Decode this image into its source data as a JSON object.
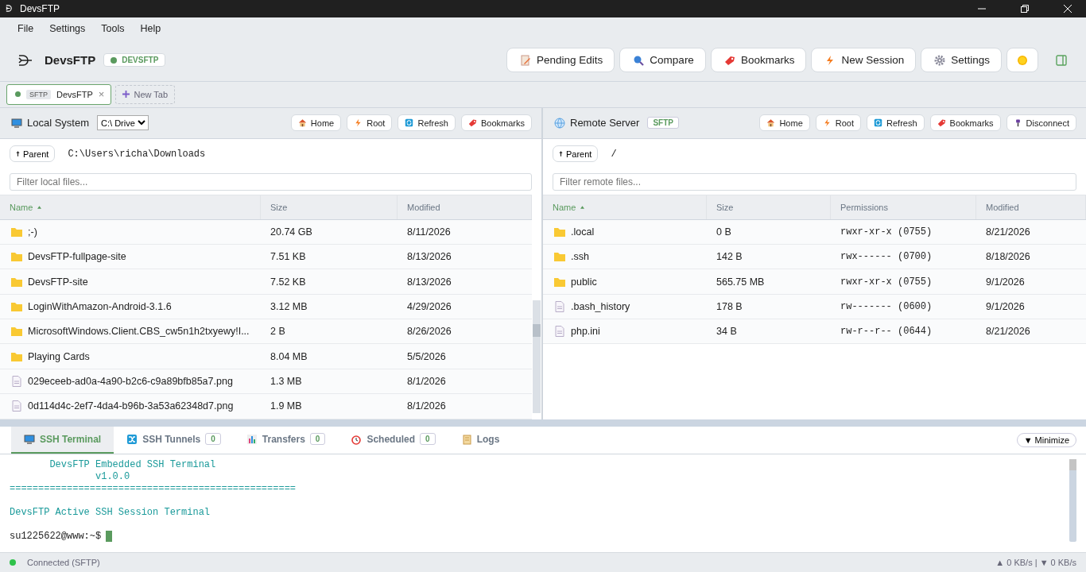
{
  "window": {
    "title": "DevsFTP"
  },
  "menu": [
    "File",
    "Settings",
    "Tools",
    "Help"
  ],
  "header": {
    "app_name": "DevsFTP",
    "badge": "DEVSFTP",
    "buttons": [
      {
        "label": "Pending Edits",
        "kind": "edit"
      },
      {
        "label": "Compare",
        "kind": "search"
      },
      {
        "label": "Bookmarks",
        "kind": "bookmark"
      },
      {
        "label": "New Session",
        "kind": "bolt"
      },
      {
        "label": "Settings",
        "kind": "gear"
      }
    ]
  },
  "session_tabs": [
    {
      "protocol": "SFTP",
      "label": "DevsFTP",
      "close": "×",
      "selected": true
    }
  ],
  "new_tab": "New Tab",
  "local": {
    "title": "Local System",
    "drive": "C:\\ Drive",
    "buttons": [
      {
        "label": "Home",
        "kind": "home"
      },
      {
        "label": "Root",
        "kind": "bolt"
      },
      {
        "label": "Refresh",
        "kind": "refresh"
      },
      {
        "label": "Bookmarks",
        "kind": "bookmark"
      }
    ],
    "parent": "Parent",
    "path": "C:\\Users\\richa\\Downloads",
    "filter_placeholder": "Filter local files...",
    "columns": [
      "Name",
      "Size",
      "Modified"
    ],
    "rows": [
      {
        "kind": "folder",
        "name": ";-)",
        "size": "20.74 GB",
        "modified": "8/11/2026"
      },
      {
        "kind": "folder",
        "name": "DevsFTP-fullpage-site",
        "size": "7.51 KB",
        "modified": "8/13/2026"
      },
      {
        "kind": "folder",
        "name": "DevsFTP-site",
        "size": "7.52 KB",
        "modified": "8/13/2026"
      },
      {
        "kind": "folder",
        "name": "LoginWithAmazon-Android-3.1.6",
        "size": "3.12 MB",
        "modified": "4/29/2026"
      },
      {
        "kind": "folder",
        "name": "MicrosoftWindows.Client.CBS_cw5n1h2txyewy!I...",
        "size": "2 B",
        "modified": "8/26/2026"
      },
      {
        "kind": "folder",
        "name": "Playing Cards",
        "size": "8.04 MB",
        "modified": "5/5/2026"
      },
      {
        "kind": "file",
        "name": "029eceeb-ad0a-4a90-b2c6-c9a89bfb85a7.png",
        "size": "1.3 MB",
        "modified": "8/1/2026"
      },
      {
        "kind": "file",
        "name": "0d114d4c-2ef7-4da4-b96b-3a53a62348d7.png",
        "size": "1.9 MB",
        "modified": "8/1/2026"
      }
    ]
  },
  "remote": {
    "title": "Remote Server",
    "badge": "SFTP",
    "buttons": [
      {
        "label": "Home",
        "kind": "home"
      },
      {
        "label": "Root",
        "kind": "bolt"
      },
      {
        "label": "Refresh",
        "kind": "refresh"
      },
      {
        "label": "Bookmarks",
        "kind": "bookmark"
      },
      {
        "label": "Disconnect",
        "kind": "plug"
      }
    ],
    "parent": "Parent",
    "path": "/",
    "filter_placeholder": "Filter remote files...",
    "columns": [
      "Name",
      "Size",
      "Permissions",
      "Modified"
    ],
    "rows": [
      {
        "kind": "folder",
        "name": ".local",
        "size": "0 B",
        "permissions": "rwxr-xr-x (0755)",
        "modified": "8/21/2026"
      },
      {
        "kind": "folder",
        "name": ".ssh",
        "size": "142 B",
        "permissions": "rwx------ (0700)",
        "modified": "8/18/2026"
      },
      {
        "kind": "folder",
        "name": "public",
        "size": "565.75 MB",
        "permissions": "rwxr-xr-x (0755)",
        "modified": "9/1/2026"
      },
      {
        "kind": "file",
        "name": ".bash_history",
        "size": "178 B",
        "permissions": "rw------- (0600)",
        "modified": "9/1/2026"
      },
      {
        "kind": "file",
        "name": "php.ini",
        "size": "34 B",
        "permissions": "rw-r--r-- (0644)",
        "modified": "8/21/2026"
      }
    ]
  },
  "bottom_tabs": [
    {
      "label": "SSH Terminal",
      "kind": "monitor",
      "selected": true
    },
    {
      "label": "SSH Tunnels",
      "kind": "shuffle",
      "count": "0",
      "selected": false
    },
    {
      "label": "Transfers",
      "kind": "chart",
      "count": "0",
      "selected": false
    },
    {
      "label": "Scheduled",
      "kind": "clock",
      "count": "0",
      "selected": false
    },
    {
      "label": "Logs",
      "kind": "scroll",
      "selected": false
    }
  ],
  "minimize": "▼ Minimize",
  "terminal": {
    "lines": [
      {
        "text": "       DevsFTP Embedded SSH Terminal",
        "blank_before": false
      },
      {
        "text": "               v1.0.0",
        "blank_before": false
      },
      {
        "text": "==================================================",
        "blank_before": false
      },
      {
        "text": "DevsFTP Active SSH Session Terminal",
        "blank_before": true
      }
    ],
    "prompt": "su1225622@www:~$"
  },
  "status_bar": {
    "status": "Connected (SFTP)",
    "speed": "▲ 0 KB/s | ▼ 0 KB/s"
  }
}
